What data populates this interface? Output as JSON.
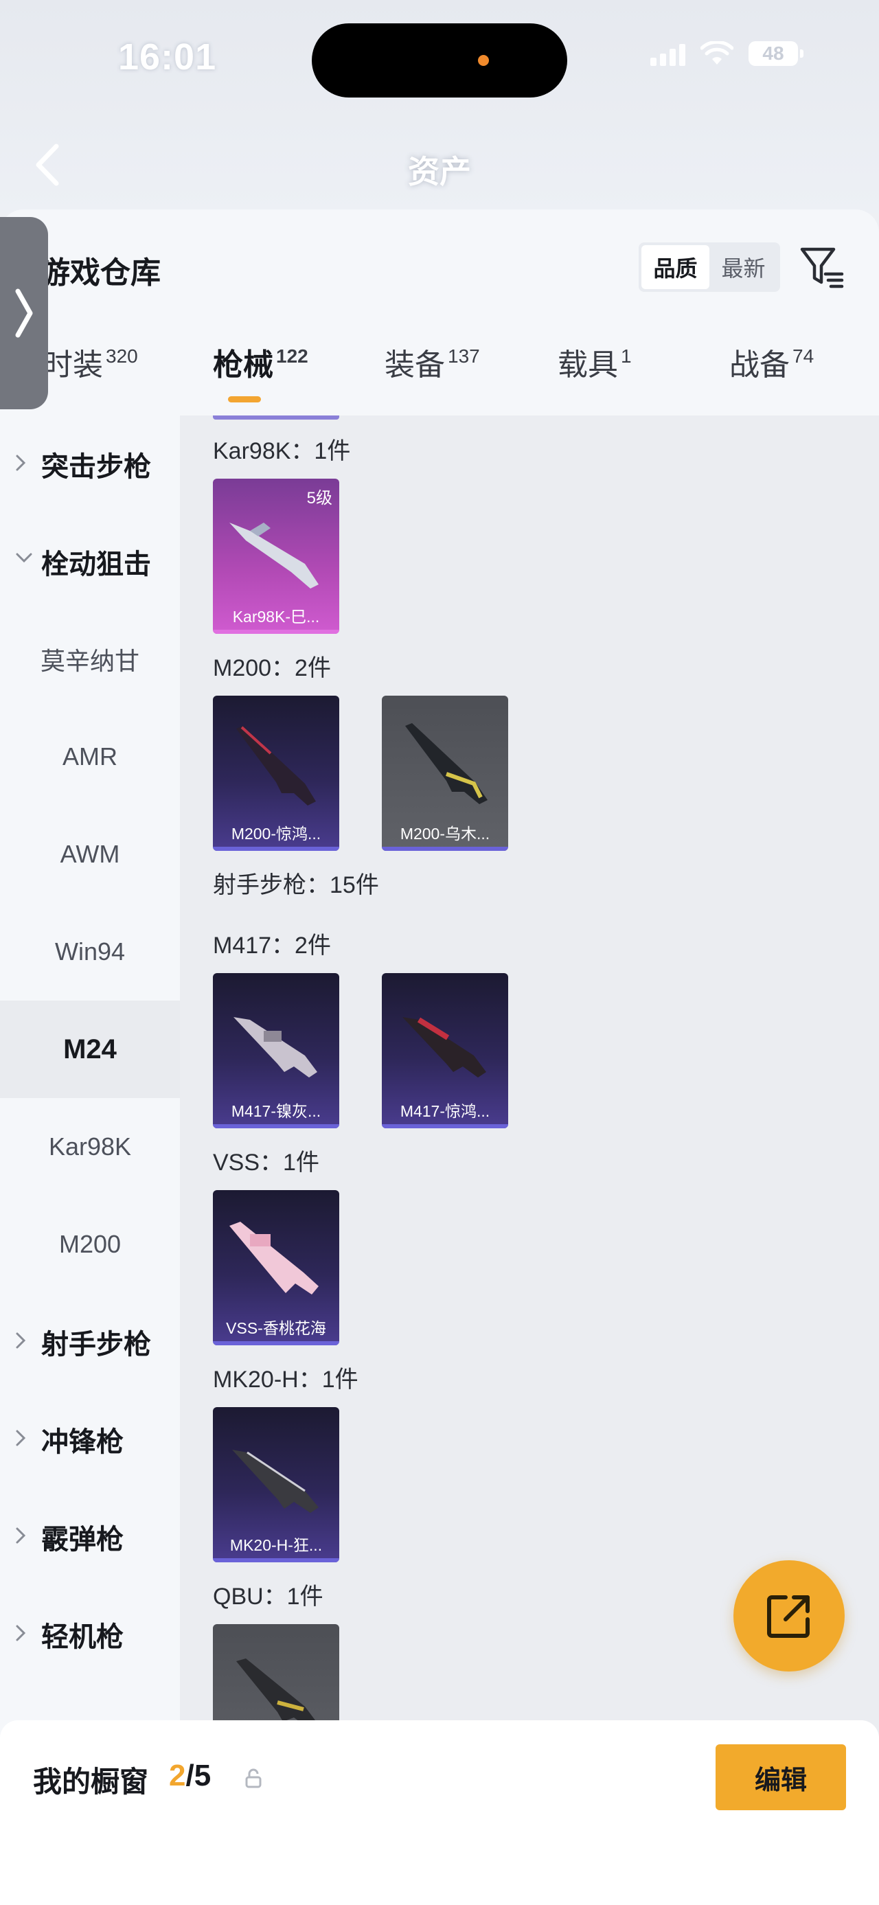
{
  "status_bar": {
    "time": "16:01",
    "battery": "48"
  },
  "nav": {
    "title": "资产"
  },
  "warehouse": {
    "title": "游戏仓库"
  },
  "sort": {
    "options": [
      "品质",
      "最新"
    ],
    "active": "品质"
  },
  "tabs": [
    {
      "label": "枪械",
      "count": "122",
      "active": true
    },
    {
      "label": "装备",
      "count": "137"
    },
    {
      "label": "载具",
      "count": "1"
    },
    {
      "label": "战备",
      "count": "74"
    }
  ],
  "side_partial": {
    "label": "时装",
    "count": "320"
  },
  "sidebar": {
    "items": [
      {
        "label": "突击步枪",
        "type": "group",
        "expanded": false
      },
      {
        "label": "栓动狙击",
        "type": "group",
        "expanded": true
      },
      {
        "label": "莫辛纳甘",
        "type": "sub"
      },
      {
        "label": "AMR",
        "type": "sub"
      },
      {
        "label": "AWM",
        "type": "sub"
      },
      {
        "label": "Win94",
        "type": "sub"
      },
      {
        "label": "M24",
        "type": "sub",
        "selected": true
      },
      {
        "label": "Kar98K",
        "type": "sub"
      },
      {
        "label": "M200",
        "type": "sub"
      },
      {
        "label": "射手步枪",
        "type": "group",
        "expanded": false
      },
      {
        "label": "冲锋枪",
        "type": "group",
        "expanded": false
      },
      {
        "label": "霰弹枪",
        "type": "group",
        "expanded": false
      },
      {
        "label": "轻机枪",
        "type": "group",
        "expanded": false
      }
    ]
  },
  "content": {
    "sections": [
      {
        "label": "Kar98K：1件",
        "items": [
          {
            "name": "Kar98K-巳...",
            "level": "5级",
            "rarity": "magenta"
          }
        ]
      },
      {
        "label": "M200：2件",
        "items": [
          {
            "name": "M200-惊鸿...",
            "rarity": "purple"
          },
          {
            "name": "M200-乌木...",
            "rarity": "gray"
          }
        ]
      },
      {
        "label": "射手步枪：15件",
        "items": []
      },
      {
        "label": "M417：2件",
        "items": [
          {
            "name": "M417-镍灰...",
            "rarity": "purple"
          },
          {
            "name": "M417-惊鸿...",
            "rarity": "purple"
          }
        ]
      },
      {
        "label": "VSS：1件",
        "items": [
          {
            "name": "VSS-香桃花海",
            "rarity": "purple"
          }
        ]
      },
      {
        "label": "MK20-H：1件",
        "items": [
          {
            "name": "MK20-H-狂...",
            "rarity": "purple"
          }
        ]
      },
      {
        "label": "QBU：1件",
        "items": [
          {
            "name": "",
            "rarity": "gray"
          }
        ]
      }
    ]
  },
  "bottom": {
    "title": "我的橱窗",
    "current": "2",
    "total": "/5",
    "edit_label": "编辑"
  },
  "colors": {
    "accent": "#f2aa2c",
    "purple_rarity": "#4a3c8f",
    "magenta_rarity": "#b24ab5"
  },
  "icons": [
    "back-arrow-icon",
    "filter-icon",
    "drawer-chevron-icon",
    "share-icon",
    "lock-icon",
    "gun-icon"
  ]
}
